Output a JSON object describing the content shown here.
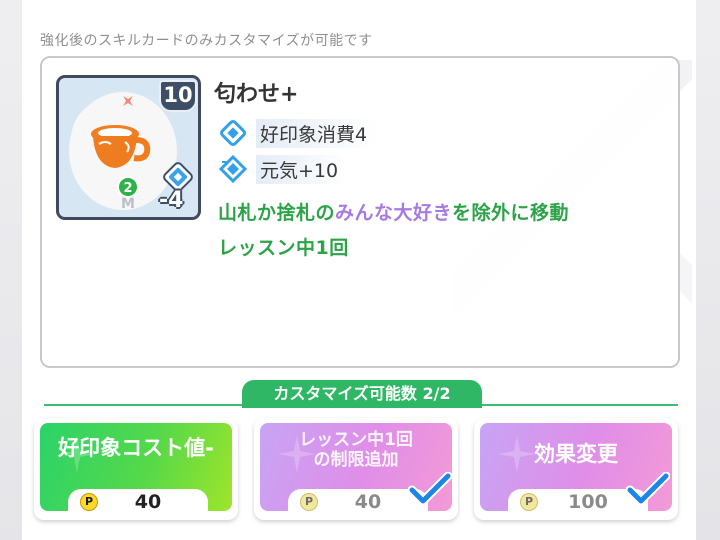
{
  "notice": "強化後のスキルカードのみカスタマイズが可能です",
  "card": {
    "name": "匂わせ+",
    "level": "10",
    "green_cost": "2",
    "cost": "-4",
    "card_mark": "M",
    "effects": [
      {
        "icon": "good-impression-icon",
        "label": "好印象消費4"
      },
      {
        "icon": "energy-icon",
        "label": "元気+10"
      }
    ],
    "description": {
      "part1": "山札か捨札の",
      "part2": "みんな大好き",
      "part3": "を除外に移動",
      "line2": "レッスン中1回"
    }
  },
  "customize_count": "カスタマイズ可能数 2/2",
  "options": [
    {
      "title": "好印象コスト値-",
      "title_line2": "",
      "cost": "40",
      "selected": false,
      "color": "green"
    },
    {
      "title": "レッスン中1回",
      "title_line2": "の制限追加",
      "cost": "40",
      "selected": true,
      "color": "pink"
    },
    {
      "title": "効果変更",
      "title_line2": "",
      "cost": "100",
      "selected": true,
      "color": "pink"
    }
  ],
  "coin_symbol": "P",
  "colors": {
    "accent_green": "#2fb765",
    "effect_text_green": "#2ba346",
    "effect_text_purple": "#a77ae3",
    "check_blue": "#1c86e6",
    "badge_navy": "#3d4e66"
  }
}
